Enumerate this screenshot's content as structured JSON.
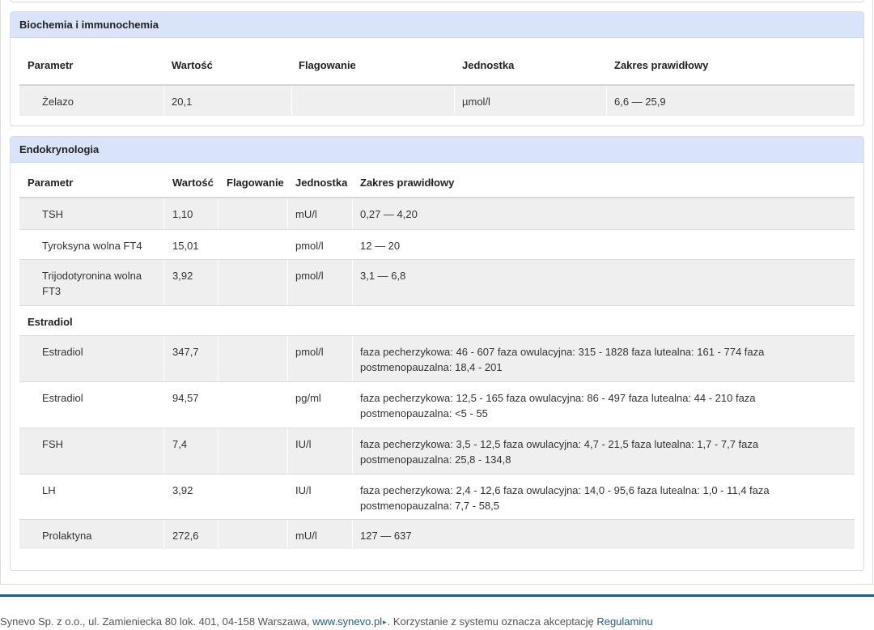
{
  "biochem": {
    "title": "Biochemia i immunochemia",
    "headers": {
      "param": "Parametr",
      "value": "Wartość",
      "flag": "Flagowanie",
      "unit": "Jednostka",
      "range": "Zakres prawidłowy"
    },
    "rows": [
      {
        "param": "Żelazo",
        "value": "20,1",
        "flag": "",
        "unit": "µmol/l",
        "range": "6,6 — 25,9"
      }
    ]
  },
  "endo": {
    "title": "Endokrynologia",
    "headers": {
      "param": "Parametr",
      "value": "Wartość",
      "flag": "Flagowanie",
      "unit": "Jednostka",
      "range": "Zakres prawidłowy"
    },
    "rows": [
      {
        "param": "TSH",
        "value": "1,10",
        "flag": "",
        "unit": "mU/l",
        "range": "0,27 — 4,20"
      },
      {
        "param": "Tyroksyna wolna FT4",
        "value": "15,01",
        "flag": "",
        "unit": "pmol/l",
        "range": "12 — 20"
      },
      {
        "param": "Trijodotyronina wolna FT3",
        "value": "3,92",
        "flag": "",
        "unit": "pmol/l",
        "range": "3,1 — 6,8"
      }
    ],
    "group_label": "Estradiol",
    "group_rows": [
      {
        "param": "Estradiol",
        "value": "347,7",
        "flag": "",
        "unit": "pmol/l",
        "range": "faza pecherzykowa: 46 - 607 faza owulacyjna: 315 - 1828 faza lutealna: 161 - 774 faza postmenopauzalna: 18,4 - 201"
      },
      {
        "param": "Estradiol",
        "value": "94,57",
        "flag": "",
        "unit": "pg/ml",
        "range": "faza pecherzykowa: 12,5 - 165 faza owulacyjna: 86 - 497 faza lutealna: 44 - 210 faza postmenopauzalna: <5 - 55"
      },
      {
        "param": "FSH",
        "value": "7,4",
        "flag": "",
        "unit": "IU/l",
        "range": "faza pecherzykowa: 3,5 - 12,5 faza owulacyjna: 4,7 - 21,5 faza lutealna: 1,7 - 7,7 faza postmenopauzalna: 25,8 - 134,8"
      },
      {
        "param": "LH",
        "value": "3,92",
        "flag": "",
        "unit": "IU/l",
        "range": "faza pecherzykowa: 2,4 - 12,6 faza owulacyjna: 14,0 - 95,6 faza lutealna: 1,0 - 11,4 faza postmenopauzalna: 7,7 - 58,5"
      },
      {
        "param": "Prolaktyna",
        "value": "272,6",
        "flag": "",
        "unit": "mU/l",
        "range": "127 — 637"
      }
    ]
  },
  "footer": {
    "company": "Synevo Sp. z o.o., ul. Zamieniecka 80 lok. 401, 04-158 Warszawa,",
    "link": "www.synevo.pl",
    "notice": ". Korzystanie z systemu oznacza akceptację",
    "terms": "Regulaminu"
  }
}
